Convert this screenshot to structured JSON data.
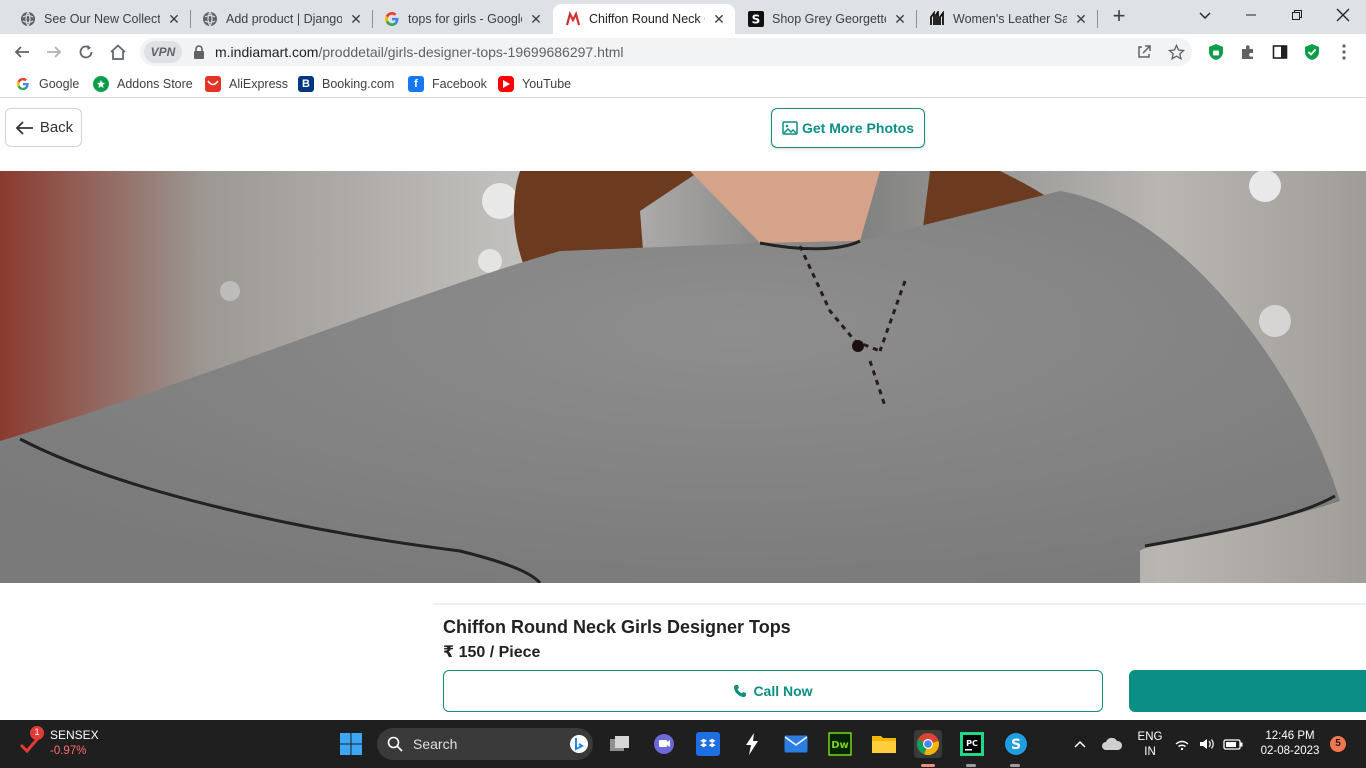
{
  "browser": {
    "tabs": [
      {
        "title": "See Our New Collectic",
        "favicon": "globe-icon",
        "active": false
      },
      {
        "title": "Add product | Django",
        "favicon": "globe-icon",
        "active": false
      },
      {
        "title": "tops for girls - Google",
        "favicon": "google-icon",
        "active": false
      },
      {
        "title": "Chiffon Round Neck G",
        "favicon": "indiamart-icon",
        "active": true
      },
      {
        "title": "Shop Grey Georgette",
        "favicon": "s-logo-icon",
        "active": false
      },
      {
        "title": "Women's Leather Sanc",
        "favicon": "bata-icon",
        "active": false
      }
    ],
    "new_tab_label": "+",
    "url": {
      "host": "m.indiamart.com",
      "path": "/proddetail/girls-designer-tops-19699686297.html"
    },
    "vpn_label": "VPN",
    "bookmarks": [
      {
        "label": "Google",
        "icon": "google-icon",
        "color": "#4285f4"
      },
      {
        "label": "Addons Store",
        "icon": "addons-icon",
        "color": "#0b9e49"
      },
      {
        "label": "AliExpress",
        "icon": "aliexpress-icon",
        "color": "#e43225"
      },
      {
        "label": "Booking.com",
        "icon": "booking-icon",
        "color": "#003580"
      },
      {
        "label": "Facebook",
        "icon": "facebook-icon",
        "color": "#1877f2"
      },
      {
        "label": "YouTube",
        "icon": "youtube-icon",
        "color": "#ff0000"
      }
    ]
  },
  "page": {
    "back_label": "Back",
    "photos_label": "Get More Photos",
    "product_title": "Chiffon Round Neck Girls Designer Tops",
    "product_price": "₹ 150 / Piece",
    "call_label": "Call Now",
    "accent_color": "#0b8f84"
  },
  "taskbar": {
    "widget_badge": "1",
    "sensex_name": "SENSEX",
    "sensex_change": "-0.97%",
    "search_label": "Search",
    "language_top": "ENG",
    "language_bottom": "IN",
    "time": "12:46 PM",
    "date": "02-08-2023",
    "notification_count": "5"
  }
}
